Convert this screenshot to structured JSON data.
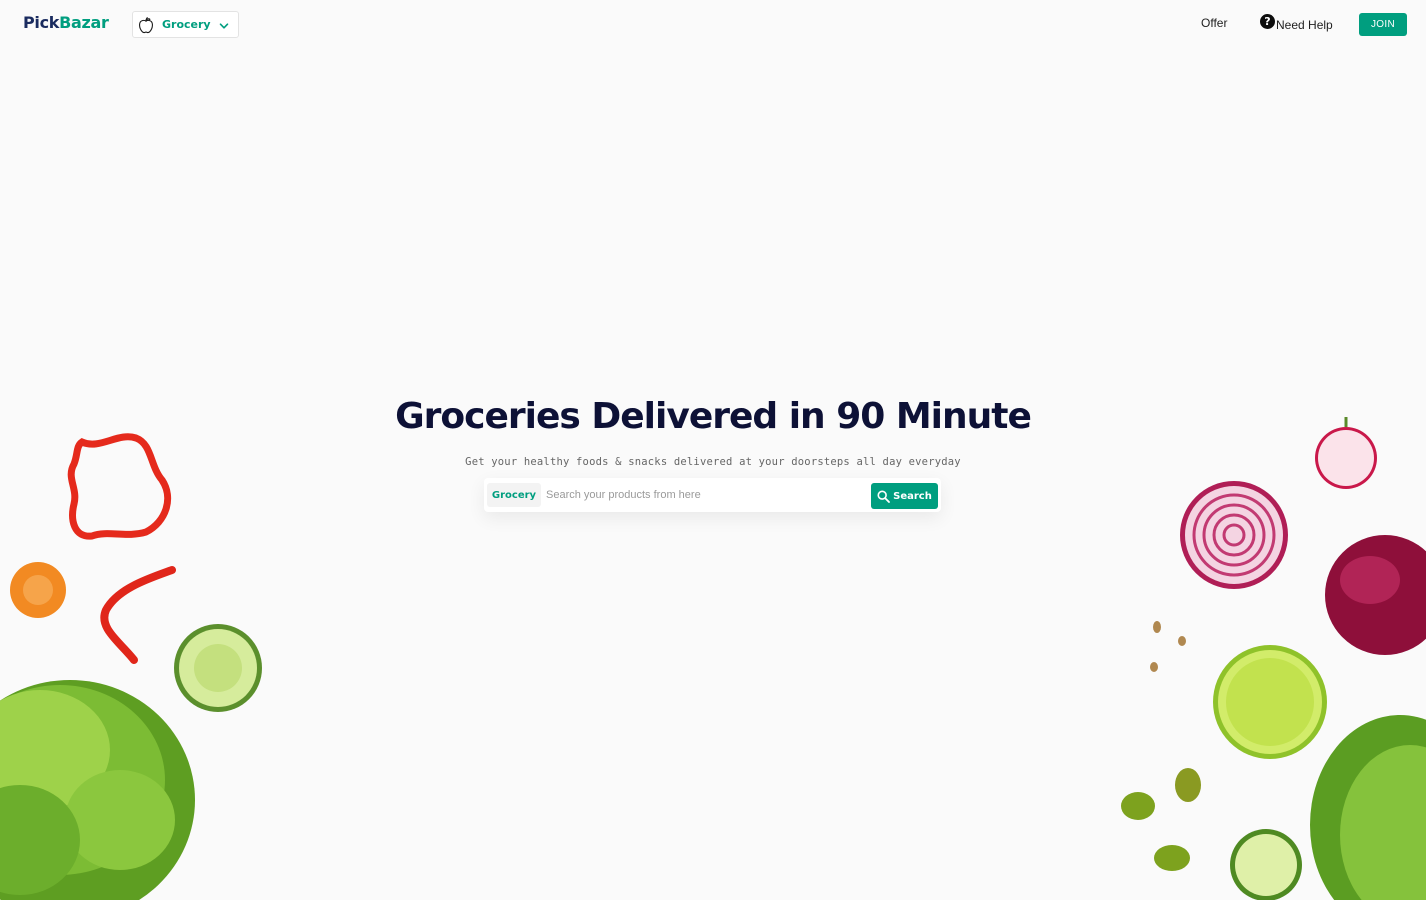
{
  "header": {
    "logo_part1": "Pick",
    "logo_part2": "Bazar",
    "type_selector": {
      "label": "Grocery",
      "icon": "apple-icon"
    },
    "nav": {
      "offer_label": "Offer",
      "help_label": "Need Help",
      "help_icon": "question-circle-icon"
    },
    "join_label": "JOIN"
  },
  "hero": {
    "title": "Groceries Delivered in 90 Minute",
    "subtitle": "Get your healthy foods & snacks delivered at your doorsteps all day everyday",
    "search": {
      "type_label": "Grocery",
      "placeholder": "Search your products from here",
      "value": "",
      "button_label": "Search",
      "button_icon": "search-icon"
    }
  },
  "colors": {
    "brand": "#009e7f",
    "logo_dark": "#1a2b5f",
    "title": "#0d1136",
    "background": "#fafafa"
  }
}
